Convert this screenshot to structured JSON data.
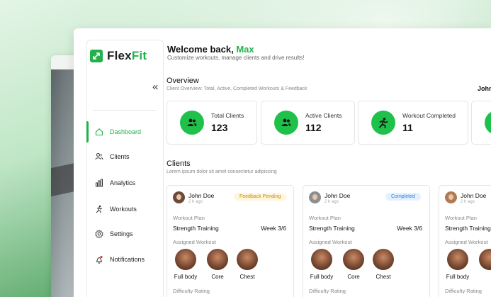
{
  "app": {
    "brand_main": "Flex",
    "brand_accent": "Fit",
    "accent_color": "#22b14c"
  },
  "sidebar": {
    "collapse_icon": "double-chevron-left",
    "items": [
      {
        "label": "Dashboard",
        "icon": "home-icon",
        "active": true
      },
      {
        "label": "Clients",
        "icon": "users-icon"
      },
      {
        "label": "Analytics",
        "icon": "bar-chart-icon"
      },
      {
        "label": "Workouts",
        "icon": "running-person-icon"
      },
      {
        "label": "Settings",
        "icon": "gear-icon"
      },
      {
        "label": "Notifications",
        "icon": "bell-icon"
      }
    ]
  },
  "header": {
    "welcome_prefix": "Welcome back,",
    "user_name": "Max",
    "subtitle": "Customize workouts, manage clients and drive results!",
    "profile_name_partial": "John"
  },
  "overview": {
    "title": "Overview",
    "subtitle": "Client Overview: Total, Active, Completed Workouts & Feedback",
    "stats": [
      {
        "label": "Total Clients",
        "value": "123",
        "icon": "users-icon"
      },
      {
        "label": "Active Clients",
        "value": "112",
        "icon": "users-icon"
      },
      {
        "label": "Workout Completed",
        "value": "11",
        "icon": "running-person-icon"
      }
    ]
  },
  "clients": {
    "title": "Clients",
    "subtitle": "Lorem ipsum dolor sit amet consectetur adipiscing",
    "cards": [
      {
        "name": "John Doe",
        "time": "2 h ago",
        "badge": "Feedback Pending",
        "plan_label": "Workout Plan",
        "plan": "Strength Training",
        "week": "Week 3/6",
        "assigned_label": "Assigned Workout",
        "workouts": [
          "Full body",
          "Core",
          "Chest"
        ],
        "difficulty_label": "Difficulty Rating"
      },
      {
        "name": "John Doe",
        "time": "2 h ago",
        "badge": "Completed",
        "plan_label": "Workout Plan",
        "plan": "Strength Training",
        "week": "Week 3/6",
        "assigned_label": "Assigned Workout",
        "workouts": [
          "Full body",
          "Core",
          "Chest"
        ],
        "difficulty_label": "Difficulty Rating"
      },
      {
        "name": "John Doe",
        "time": "2 h ago",
        "plan_label": "Workout Plan",
        "plan": "Strength Training",
        "assigned_label": "Assigned Workout",
        "workouts": [
          "Full body"
        ],
        "difficulty_label": "Difficulty Rating"
      }
    ]
  }
}
